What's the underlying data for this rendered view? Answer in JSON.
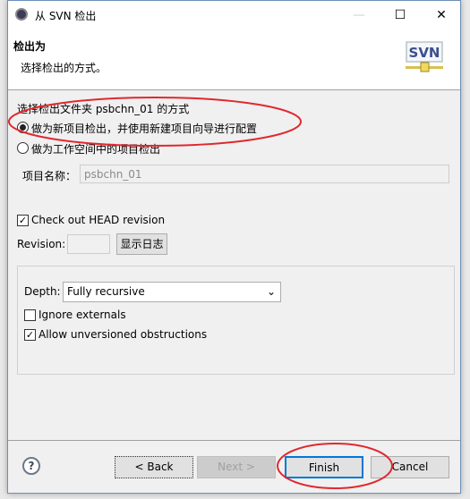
{
  "window": {
    "title": "从 SVN 检出",
    "minimize": "—",
    "maximize": "☐",
    "close": "✕"
  },
  "header": {
    "title": "检出为",
    "description": "选择检出的方式。",
    "logo_text": "SVN"
  },
  "checkout": {
    "prompt": "选择检出文件夹 psbchn_01 的方式",
    "options": [
      {
        "label": "做为新项目检出，并使用新建项目向导进行配置",
        "selected": true
      },
      {
        "label": "做为工作空间中的项目检出",
        "selected": false
      }
    ],
    "project_name_label": "项目名称：",
    "project_name_value": "psbchn_01"
  },
  "revision": {
    "head_label": "Check out HEAD revision",
    "head_checked": true,
    "revision_label": "Revision:",
    "revision_value": "",
    "show_log": "显示日志"
  },
  "options": {
    "depth_label": "Depth:",
    "depth_value": "Fully recursive",
    "ignore_externals": "Ignore externals",
    "ignore_checked": false,
    "allow_unversioned": "Allow unversioned obstructions",
    "allow_checked": true
  },
  "footer": {
    "help": "?",
    "back": "< Back",
    "next": "Next >",
    "finish": "Finish",
    "cancel": "Cancel"
  },
  "annotation_color": "#e0282e"
}
